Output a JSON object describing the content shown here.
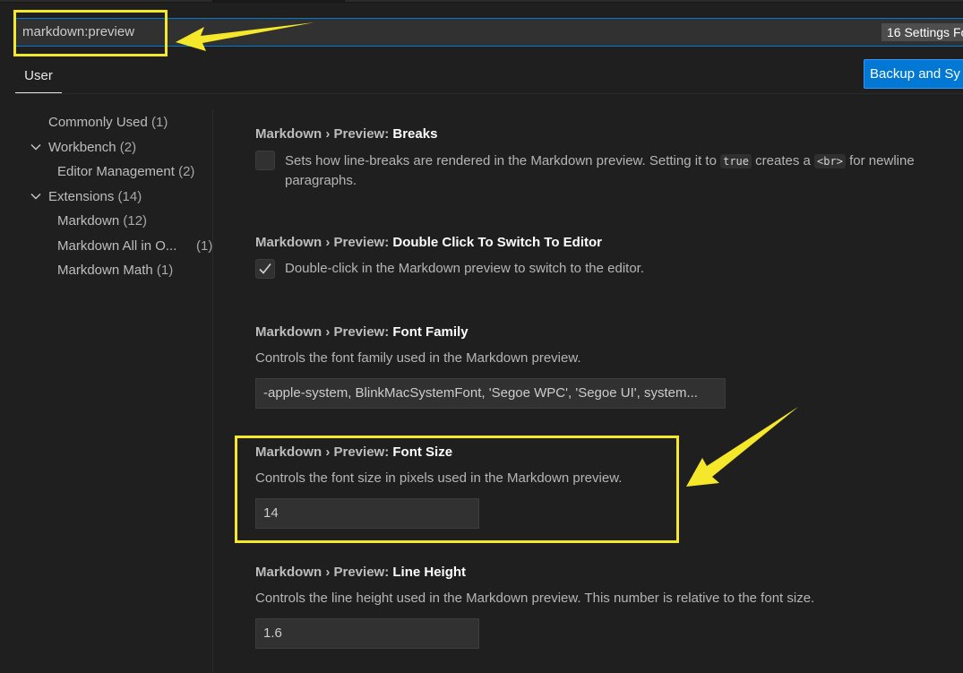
{
  "search": {
    "value": "markdown:preview",
    "result_count": "16 Settings Fo"
  },
  "tabs": [
    {
      "label": "User"
    }
  ],
  "backup_button": "Backup and Sy",
  "toc": [
    {
      "label": "Commonly Used",
      "count": "(1)"
    },
    {
      "label": "Workbench",
      "count": "(2)"
    },
    {
      "label": "Editor Management",
      "count": "(2)"
    },
    {
      "label": "Extensions",
      "count": "(14)"
    },
    {
      "label": "Markdown",
      "count": "(12)"
    },
    {
      "label": "Markdown All in O...",
      "count": "(1)"
    },
    {
      "label": "Markdown Math",
      "count": "(1)"
    }
  ],
  "settings": {
    "breaks": {
      "category": "Markdown › Preview:",
      "key": "Breaks",
      "desc_1": "Sets how line-breaks are rendered in the Markdown preview. Setting it to",
      "code_true": "true",
      "desc_2": "creates a",
      "code_br": "<br>",
      "desc_3": "for newline",
      "desc_line2": "paragraphs.",
      "checked": false
    },
    "double_click": {
      "category": "Markdown › Preview:",
      "key": "Double Click To Switch To Editor",
      "desc": "Double-click in the Markdown preview to switch to the editor.",
      "checked": true
    },
    "font_family": {
      "category": "Markdown › Preview:",
      "key": "Font Family",
      "desc": "Controls the font family used in the Markdown preview.",
      "value": "-apple-system, BlinkMacSystemFont, 'Segoe WPC', 'Segoe UI', system..."
    },
    "font_size": {
      "category": "Markdown › Preview:",
      "key": "Font Size",
      "desc": "Controls the font size in pixels used in the Markdown preview.",
      "value": "14"
    },
    "line_height": {
      "category": "Markdown › Preview:",
      "key": "Line Height",
      "desc": "Controls the line height used in the Markdown preview. This number is relative to the font size.",
      "value": "1.6"
    }
  },
  "colors": {
    "background": "#1f1f1f",
    "accent": "#0078d4",
    "annotation": "#f5e82a"
  }
}
